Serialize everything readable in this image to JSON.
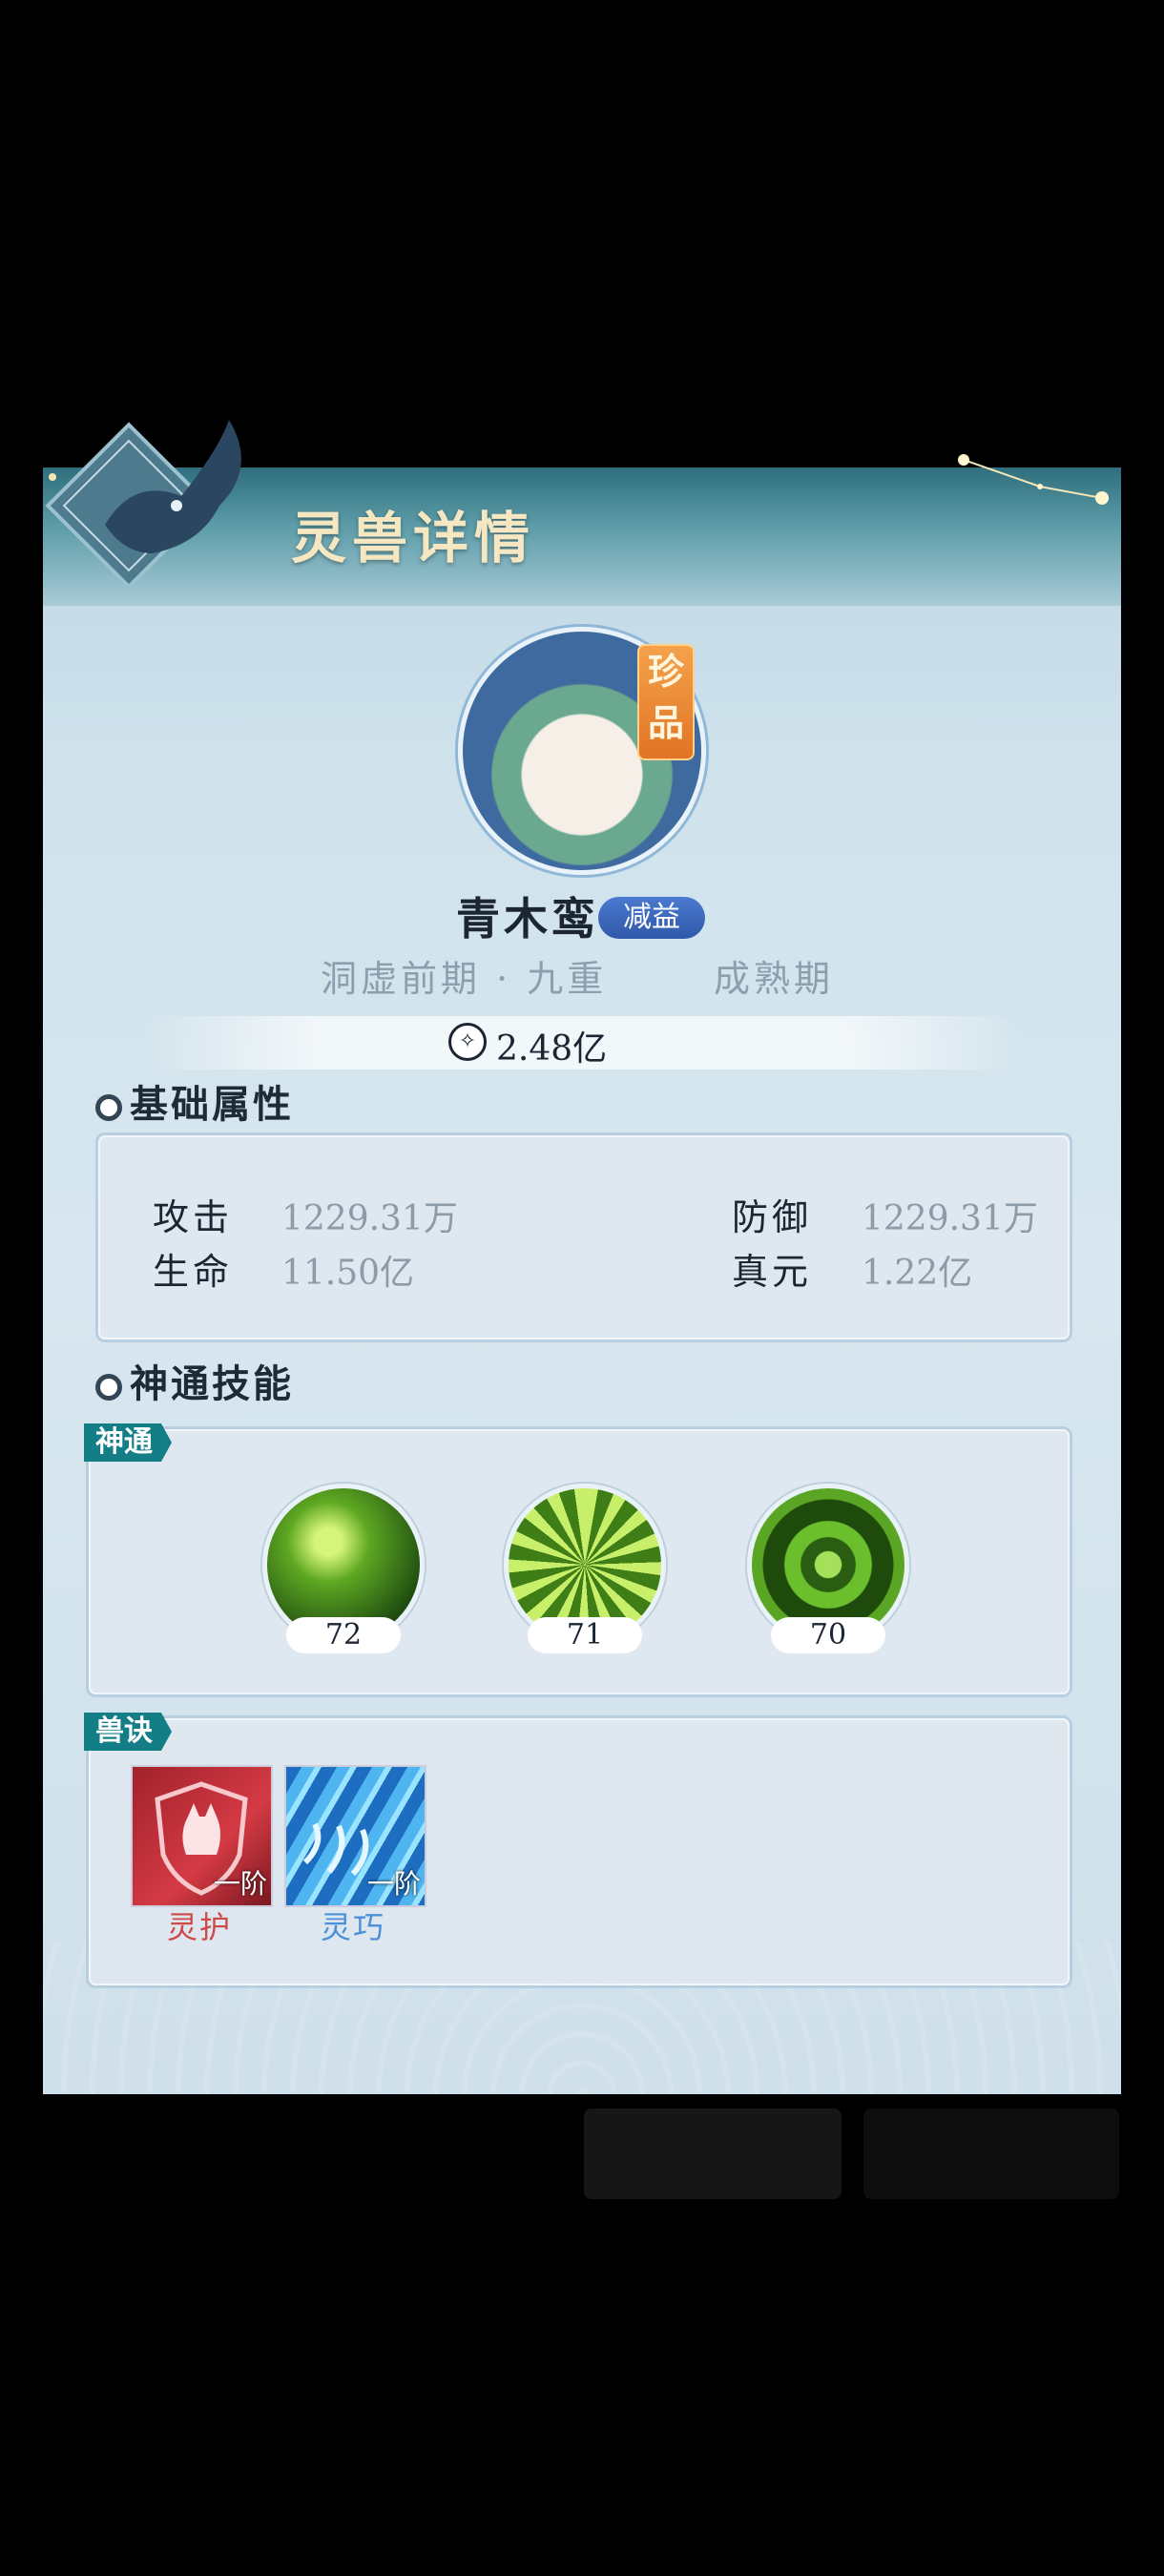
{
  "panel": {
    "title": "灵兽详情"
  },
  "beast": {
    "name": "青木鸾",
    "rank": "珍品",
    "effect_badge": "减益",
    "realm": "洞虚前期 · 九重",
    "stage": "成熟期",
    "power": "2.48亿"
  },
  "sections": {
    "base_attrs": "基础属性",
    "skills": "神通技能"
  },
  "attrs": [
    {
      "label": "攻击",
      "value": "1229.31万"
    },
    {
      "label": "防御",
      "value": "1229.31万"
    },
    {
      "label": "生命",
      "value": "11.50亿"
    },
    {
      "label": "真元",
      "value": "1.22亿"
    }
  ],
  "shentong": {
    "tag": "神通",
    "skills": [
      {
        "level": "72"
      },
      {
        "level": "71"
      },
      {
        "level": "70"
      }
    ]
  },
  "shoujue": {
    "tag": "兽诀",
    "items": [
      {
        "name": "灵护",
        "tier": "一阶",
        "color": "#d04848"
      },
      {
        "name": "灵巧",
        "tier": "一阶",
        "color": "#4a90d8"
      }
    ]
  },
  "colors": {
    "accent_teal": "#137e86",
    "title_gold": "#f4e7c2",
    "rank_orange": "#e07424"
  },
  "icons": [
    "power-icon",
    "beast-emblem",
    "constellation-deco"
  ]
}
